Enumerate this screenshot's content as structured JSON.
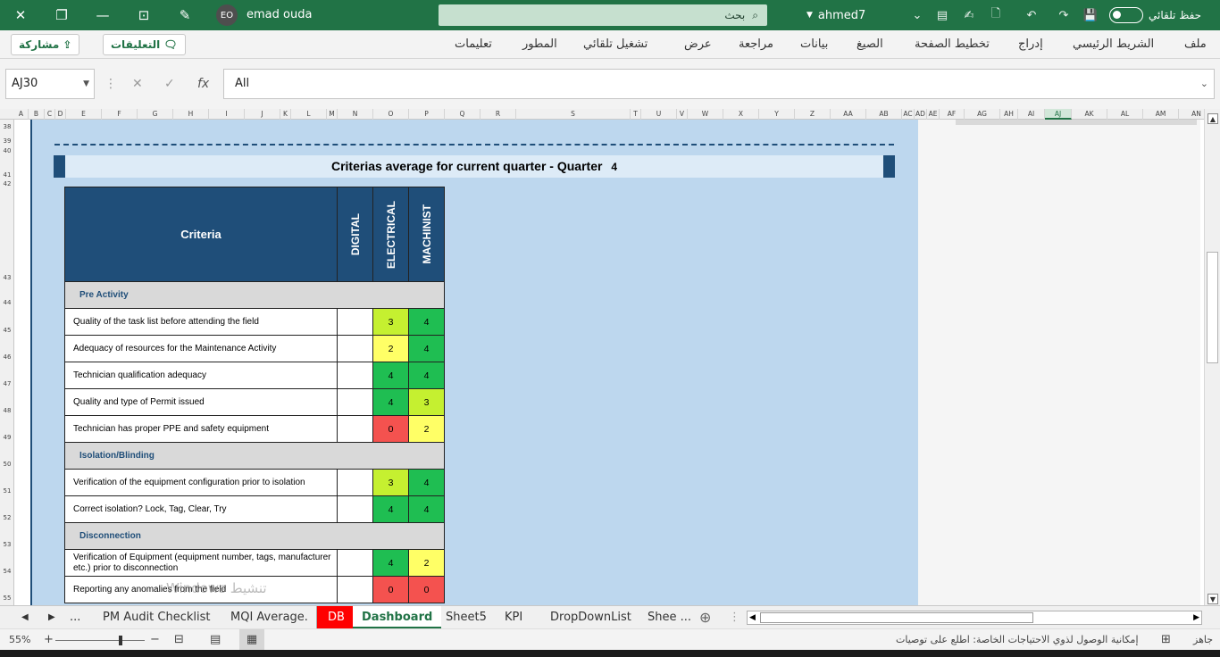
{
  "titlebar": {
    "close_icon": "✕",
    "restore_icon": "❐",
    "minimize_icon": "—",
    "user_initials": "EO",
    "user_name": "emad ouda",
    "search_placeholder": "بحث",
    "file_name": "ahmed7",
    "autosave_label": "حفظ تلقائي"
  },
  "ribbon": {
    "tabs": [
      "ملف",
      "الشريط الرئيسي",
      "إدراج",
      "تخطيط الصفحة",
      "الصيغ",
      "بيانات",
      "مراجعة",
      "عرض",
      "تشغيل تلقائي",
      "المطور",
      "تعليمات"
    ],
    "share_label": "مشاركة",
    "comments_label": "التعليقات"
  },
  "formula_bar": {
    "name_box": "AJ30",
    "fx_label": "fx",
    "value": "All"
  },
  "columns": [
    "A",
    "B",
    "C",
    "D",
    "E",
    "F",
    "G",
    "H",
    "I",
    "J",
    "K",
    "L",
    "M",
    "N",
    "O",
    "P",
    "Q",
    "R",
    "S",
    "T",
    "U",
    "V",
    "W",
    "X",
    "Y",
    "Z",
    "AA",
    "AB",
    "AC",
    "AD",
    "AE",
    "AF",
    "AG",
    "AH",
    "AI",
    "AJ",
    "AK",
    "AL",
    "AM",
    "AN"
  ],
  "rows": [
    "38",
    "39",
    "40",
    "41",
    "42",
    "43",
    "44",
    "45",
    "46",
    "47",
    "48",
    "49",
    "50",
    "51",
    "52",
    "53",
    "54",
    "55"
  ],
  "dashboard": {
    "title": "Criterias average for current quarter - Quarter",
    "quarter": "4",
    "header_criteria": "Criteria",
    "header_cols": [
      "DIGITAL",
      "ELECTRICAL",
      "MACHINIST"
    ],
    "sections": [
      {
        "name": "Pre Activity",
        "items": [
          {
            "label": "Quality of the task list before attending the field",
            "digital": "",
            "electrical": "3",
            "machinist": "4",
            "e_color": "c-yg",
            "m_color": "c-green"
          },
          {
            "label": "Adequacy of resources for the  Maintenance Activity",
            "digital": "",
            "electrical": "2",
            "machinist": "4",
            "e_color": "c-yel",
            "m_color": "c-green"
          },
          {
            "label": "Technician qualification adequacy",
            "digital": "",
            "electrical": "4",
            "machinist": "4",
            "e_color": "c-green",
            "m_color": "c-green"
          },
          {
            "label": "Quality and type of Permit issued",
            "digital": "",
            "electrical": "4",
            "machinist": "3",
            "e_color": "c-green",
            "m_color": "c-yg"
          },
          {
            "label": "Technician has proper PPE and  safety equipment",
            "digital": "",
            "electrical": "0",
            "machinist": "2",
            "e_color": "c-red",
            "m_color": "c-yel"
          }
        ]
      },
      {
        "name": "Isolation/Blinding",
        "items": [
          {
            "label": "Verification of the equipment configuration prior to isolation",
            "digital": "",
            "electrical": "3",
            "machinist": "4",
            "e_color": "c-yg",
            "m_color": "c-green"
          },
          {
            "label": "Correct isolation? Lock, Tag, Clear, Try",
            "digital": "",
            "electrical": "4",
            "machinist": "4",
            "e_color": "c-green",
            "m_color": "c-green"
          }
        ]
      },
      {
        "name": "Disconnection",
        "items": [
          {
            "label": "Verification of Equipment (equipment number, tags, manufacturer etc.) prior to disconnection",
            "digital": "",
            "electrical": "4",
            "machinist": "2",
            "e_color": "c-green",
            "m_color": "c-yel"
          },
          {
            "label": "Reporting any anomalies from the field",
            "digital": "",
            "electrical": "0",
            "machinist": "0",
            "e_color": "c-red",
            "m_color": "c-red"
          }
        ]
      }
    ]
  },
  "watermark_text": "Windows تنشيط",
  "sheet_tabs": {
    "more": "...",
    "tabs": [
      "PM Audit Checklist",
      "MQI Average.",
      "DB",
      "Dashboard",
      "Sheet5",
      "KPI",
      "DropDownList",
      "Shee ..."
    ],
    "active": "Dashboard"
  },
  "status": {
    "zoom": "55%",
    "ready": "جاهز",
    "accessibility": "إمكانية الوصول لذوي الاحتياجات الخاصة: اطلع على توصيات"
  }
}
